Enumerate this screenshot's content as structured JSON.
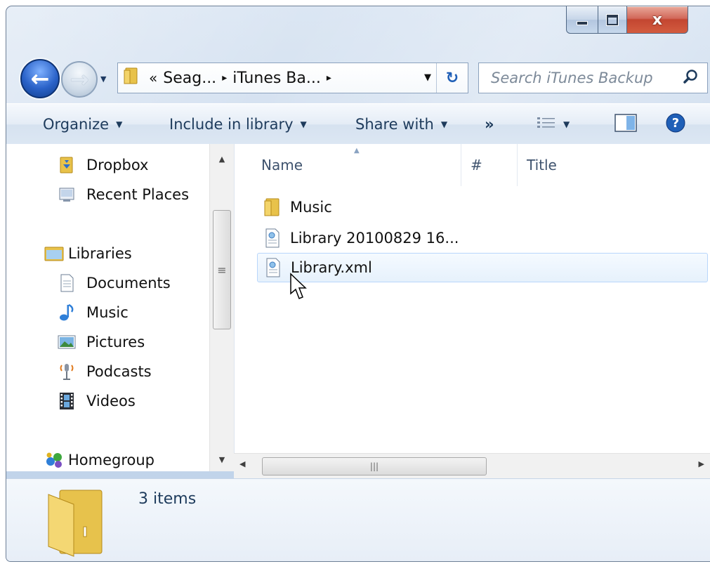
{
  "window": {
    "caption": {
      "close_glyph": "x"
    }
  },
  "nav": {
    "back_glyph": "←",
    "forward_glyph": "→"
  },
  "address": {
    "overflow": "«",
    "segments": [
      "Seag...",
      "iTunes Ba..."
    ],
    "separator": "▸",
    "refresh_glyph": "↻"
  },
  "search": {
    "placeholder": "Search iTunes Backup"
  },
  "toolbar": {
    "organize": "Organize",
    "include_in_library": "Include in library",
    "share_with": "Share with",
    "more": "»"
  },
  "navpane": {
    "favorites": [
      {
        "label": "Dropbox",
        "icon": "dropbox-icon"
      },
      {
        "label": "Recent Places",
        "icon": "recent-places-icon"
      }
    ],
    "libraries": {
      "label": "Libraries",
      "icon": "libraries-icon"
    },
    "library_items": [
      {
        "label": "Documents",
        "icon": "documents-icon"
      },
      {
        "label": "Music",
        "icon": "music-icon"
      },
      {
        "label": "Pictures",
        "icon": "pictures-icon"
      },
      {
        "label": "Podcasts",
        "icon": "podcasts-icon"
      },
      {
        "label": "Videos",
        "icon": "videos-icon"
      }
    ],
    "homegroup": {
      "label": "Homegroup",
      "icon": "homegroup-icon"
    }
  },
  "columns": {
    "name": "Name",
    "number": "#",
    "title": "Title"
  },
  "files": [
    {
      "name": "Music",
      "type": "folder",
      "selected": false
    },
    {
      "name": "Library 20100829 16...",
      "type": "xml",
      "selected": false
    },
    {
      "name": "Library.xml",
      "type": "xml",
      "selected": true
    }
  ],
  "details": {
    "count": "3 items"
  },
  "colors": {
    "accent": "#1f5fb7",
    "selection_border": "#b8d6fb",
    "close_red": "#c34631"
  }
}
